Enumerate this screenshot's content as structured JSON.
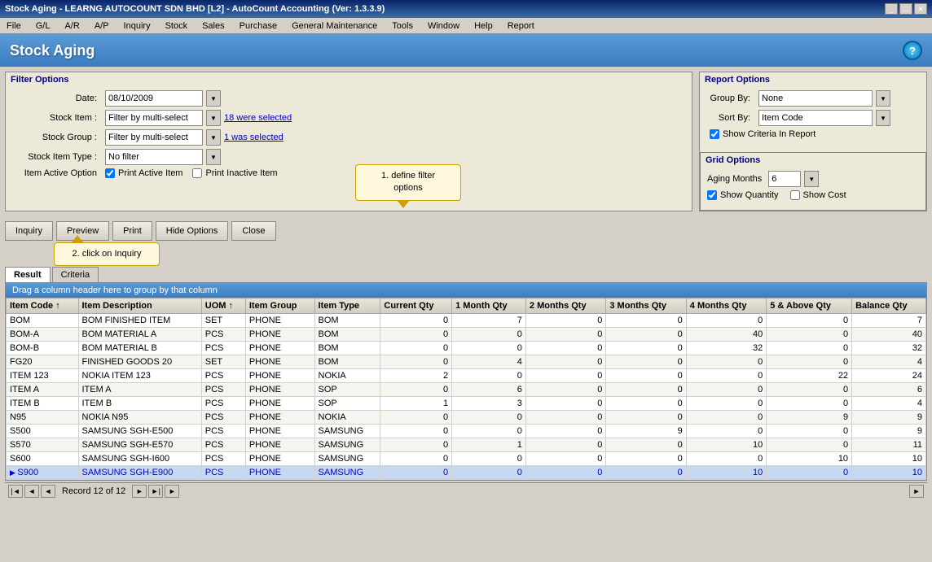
{
  "window": {
    "title": "Stock Aging - LEARNG AUTOCOUNT SDN BHD [L2] - AutoCount Accounting (Ver: 1.3.3.9)",
    "controls": [
      "_",
      "□",
      "✕"
    ]
  },
  "menubar": {
    "items": [
      "File",
      "G/L",
      "A/R",
      "A/P",
      "Inquiry",
      "Stock",
      "Sales",
      "Purchase",
      "General Maintenance",
      "Tools",
      "Window",
      "Help",
      "Report"
    ]
  },
  "header": {
    "title": "Stock Aging",
    "help_label": "?"
  },
  "filter_options": {
    "panel_title": "Filter Options",
    "date_label": "Date:",
    "date_value": "08/10/2009",
    "stock_item_label": "Stock Item :",
    "stock_item_value": "Filter by multi-select",
    "stock_item_link": "18 were selected",
    "stock_group_label": "Stock Group :",
    "stock_group_value": "Filter by multi-select",
    "stock_group_link": "1 was selected",
    "stock_item_type_label": "Stock Item Type :",
    "stock_item_type_value": "No filter",
    "item_active_label": "Item Active Option",
    "print_active_label": "Print Active Item",
    "print_inactive_label": "Print Inactive Item"
  },
  "report_options": {
    "panel_title": "Report Options",
    "group_by_label": "Group By:",
    "group_by_value": "None",
    "sort_by_label": "Sort By:",
    "sort_by_value": "Item Code",
    "show_criteria_label": "Show Criteria In Report"
  },
  "grid_options": {
    "panel_title": "Grid Options",
    "aging_months_label": "Aging Months",
    "aging_months_value": "6",
    "show_quantity_label": "Show Quantity",
    "show_cost_label": "Show Cost"
  },
  "toolbar": {
    "inquiry_label": "Inquiry",
    "preview_label": "Preview",
    "print_label": "Print",
    "hide_options_label": "Hide Options",
    "close_label": "Close"
  },
  "tabs": {
    "result_label": "Result",
    "criteria_label": "Criteria"
  },
  "callout1": {
    "text": "1. define filter\n    options"
  },
  "callout2": {
    "text": "2. click on Inquiry"
  },
  "drag_header": {
    "text": "Drag a column header here to group by that column"
  },
  "table": {
    "columns": [
      "Item Code ↑",
      "Item Description",
      "UOM ↑",
      "Item Group",
      "Item Type",
      "Current Qty",
      "1 Month Qty",
      "2 Months Qty",
      "3 Months Qty",
      "4 Months Qty",
      "5 & Above Qty",
      "Balance Qty"
    ],
    "rows": [
      [
        "BOM",
        "BOM FINISHED ITEM",
        "SET",
        "PHONE",
        "BOM",
        "0",
        "7",
        "0",
        "0",
        "0",
        "0",
        "7"
      ],
      [
        "BOM-A",
        "BOM MATERIAL A",
        "PCS",
        "PHONE",
        "BOM",
        "0",
        "0",
        "0",
        "0",
        "40",
        "0",
        "40"
      ],
      [
        "BOM-B",
        "BOM MATERIAL B",
        "PCS",
        "PHONE",
        "BOM",
        "0",
        "0",
        "0",
        "0",
        "32",
        "0",
        "32"
      ],
      [
        "FG20",
        "FINISHED GOODS 20",
        "SET",
        "PHONE",
        "BOM",
        "0",
        "4",
        "0",
        "0",
        "0",
        "0",
        "4"
      ],
      [
        "ITEM 123",
        "NOKIA ITEM 123",
        "PCS",
        "PHONE",
        "NOKIA",
        "2",
        "0",
        "0",
        "0",
        "0",
        "22",
        "24"
      ],
      [
        "ITEM A",
        "ITEM A",
        "PCS",
        "PHONE",
        "SOP",
        "0",
        "6",
        "0",
        "0",
        "0",
        "0",
        "6"
      ],
      [
        "ITEM B",
        "ITEM B",
        "PCS",
        "PHONE",
        "SOP",
        "1",
        "3",
        "0",
        "0",
        "0",
        "0",
        "4"
      ],
      [
        "N95",
        "NOKIA N95",
        "PCS",
        "PHONE",
        "NOKIA",
        "0",
        "0",
        "0",
        "0",
        "0",
        "9",
        "9"
      ],
      [
        "S500",
        "SAMSUNG SGH-E500",
        "PCS",
        "PHONE",
        "SAMSUNG",
        "0",
        "0",
        "0",
        "9",
        "0",
        "0",
        "9"
      ],
      [
        "S570",
        "SAMSUNG SGH-E570",
        "PCS",
        "PHONE",
        "SAMSUNG",
        "0",
        "1",
        "0",
        "0",
        "10",
        "0",
        "11"
      ],
      [
        "S600",
        "SAMSUNG SGH-I600",
        "PCS",
        "PHONE",
        "SAMSUNG",
        "0",
        "0",
        "0",
        "0",
        "0",
        "10",
        "10"
      ],
      [
        "S900",
        "SAMSUNG SGH-E900",
        "PCS",
        "PHONE",
        "SAMSUNG",
        "0",
        "0",
        "0",
        "0",
        "10",
        "0",
        "10"
      ]
    ],
    "selected_row_index": 11
  },
  "status_bar": {
    "record_text": "Record 12 of 12",
    "nav_buttons": [
      "|◄",
      "◄",
      "◄",
      "►",
      "►|",
      "►"
    ]
  }
}
